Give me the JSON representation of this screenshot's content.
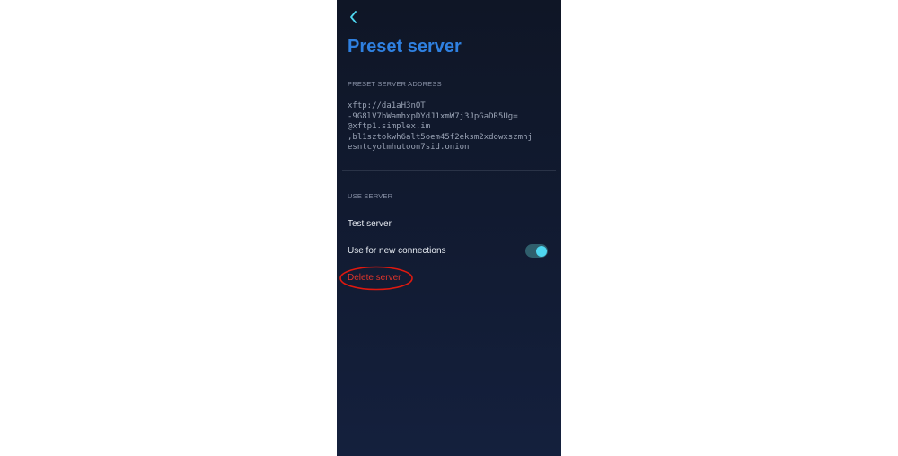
{
  "header": {
    "back_icon": "chevron-left-icon",
    "title": "Preset server"
  },
  "address_section": {
    "header": "PRESET SERVER ADDRESS",
    "lines": [
      "xftp://da1aH3nOT",
      "-9G8lV7bWamhxpDYdJ1xmW7j3JpGaDR5Ug=",
      "@xftp1.simplex.im",
      ",bl1sztokwh6alt5oem45f2eksm2xdowxszmhj",
      "esntcyolmhutoon7sid.onion"
    ]
  },
  "use_section": {
    "header": "USE SERVER",
    "test_label": "Test server",
    "use_new_label": "Use for new connections",
    "use_new_enabled": true,
    "delete_label": "Delete server"
  },
  "colors": {
    "title": "#2f80e0",
    "accent_toggle": "#4ed6f0",
    "delete": "#e0352b",
    "annotation": "#e0190f"
  }
}
